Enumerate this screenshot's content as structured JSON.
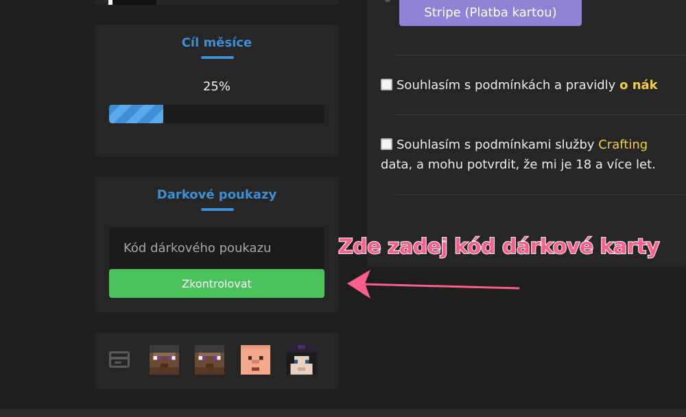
{
  "goal": {
    "title": "Cíl měsíce",
    "percent_label": "25%",
    "progress": 0.25
  },
  "gift": {
    "title": "Darkové poukazy",
    "placeholder": "Kód dárkového poukazu",
    "button_label": "Zkontrolovat"
  },
  "payment": {
    "stripe_label": "Stripe (Platba kartou)"
  },
  "agreements": {
    "first_text": "Souhlasím s podmínkách a pravidly ",
    "first_link": "o nák",
    "second_text": "Souhlasím s podmínkami služby ",
    "second_link": "Crafting",
    "second_text_line2": "data, a mohu potvrdit, že mi je 18 a více let."
  },
  "annotation": "Zde zadej kód dárkové karty",
  "icons": [
    "credit-card-icon",
    "player-head-icon",
    "player-head-icon",
    "player-head-icon",
    "player-head-icon"
  ],
  "colors": {
    "accent": "#3d8fd6",
    "button_green": "#4cc25c",
    "stripe_purple": "#8f83d6",
    "annotation_pink": "#ff5f8e",
    "link_yellow": "#f5d03a"
  }
}
